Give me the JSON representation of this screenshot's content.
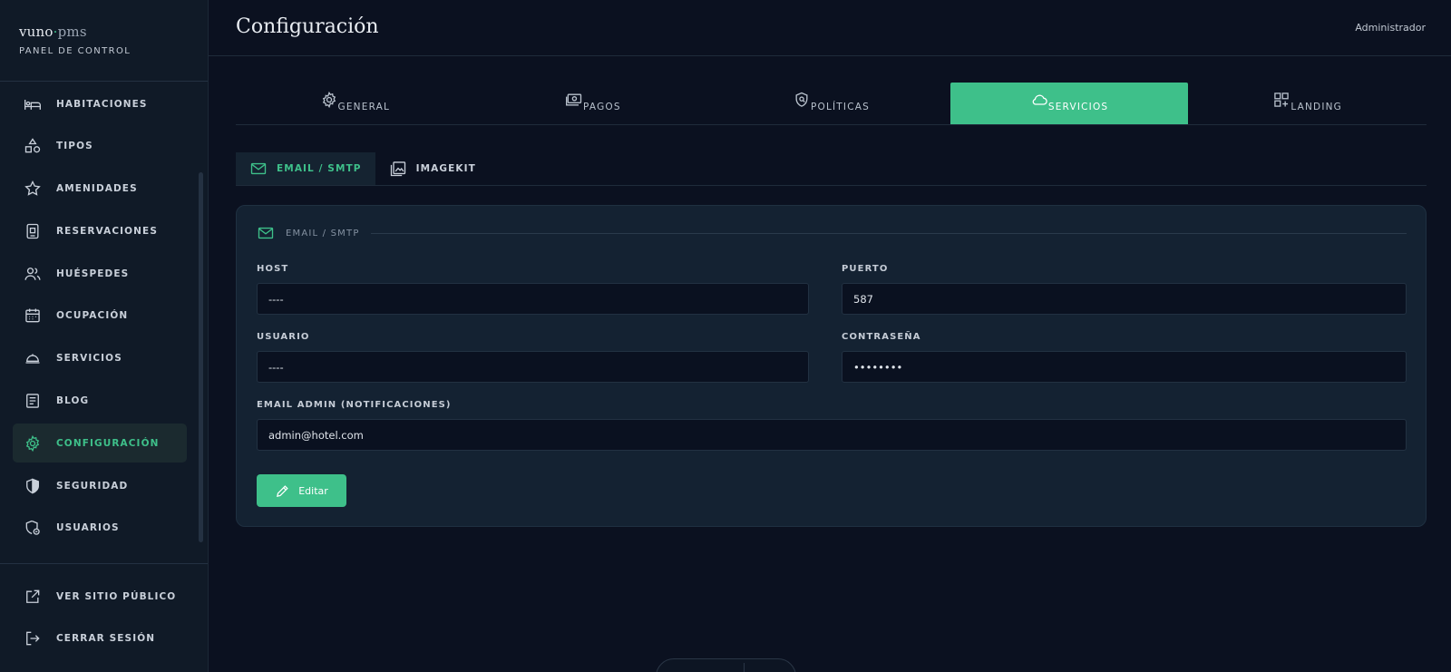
{
  "brand": {
    "logo_main": "vuno",
    "logo_dot": "·",
    "logo_pms": "pms",
    "subtitle": "PANEL DE CONTROL"
  },
  "sidebar": {
    "items": [
      {
        "label": "HABITACIONES",
        "icon": "bed-icon"
      },
      {
        "label": "TIPOS",
        "icon": "shapes-icon"
      },
      {
        "label": "AMENIDADES",
        "icon": "star-icon"
      },
      {
        "label": "RESERVACIONES",
        "icon": "booking-icon"
      },
      {
        "label": "HUÉSPEDES",
        "icon": "users-icon"
      },
      {
        "label": "OCUPACIÓN",
        "icon": "calendar-icon"
      },
      {
        "label": "SERVICIOS",
        "icon": "room-service-icon"
      },
      {
        "label": "BLOG",
        "icon": "document-icon"
      },
      {
        "label": "CONFIGURACIÓN",
        "icon": "gear-icon",
        "active": true
      },
      {
        "label": "SEGURIDAD",
        "icon": "shield-icon"
      },
      {
        "label": "USUARIOS",
        "icon": "user-shield-icon"
      }
    ],
    "bottom": [
      {
        "label": "VER SITIO PÚBLICO",
        "icon": "external-link-icon"
      },
      {
        "label": "CERRAR SESIÓN",
        "icon": "logout-icon"
      }
    ]
  },
  "header": {
    "title": "Configuración",
    "user": "Administrador"
  },
  "main_tabs": [
    {
      "label": "GENERAL",
      "icon": "gear-icon"
    },
    {
      "label": "PAGOS",
      "icon": "money-icon"
    },
    {
      "label": "POLÍTICAS",
      "icon": "policy-shield-icon"
    },
    {
      "label": "SERVICIOS",
      "icon": "cloud-icon",
      "active": true
    },
    {
      "label": "LANDING",
      "icon": "grid-plus-icon"
    }
  ],
  "sub_tabs": [
    {
      "label": "EMAIL / SMTP",
      "icon": "mail-icon",
      "active": true
    },
    {
      "label": "IMAGEKIT",
      "icon": "image-icon"
    }
  ],
  "form": {
    "section_title": "EMAIL / SMTP",
    "host_label": "HOST",
    "host_value": "----",
    "port_label": "PUERTO",
    "port_value": "587",
    "user_label": "USUARIO",
    "user_value": "----",
    "password_label": "CONTRASEÑA",
    "password_value": "••••••••",
    "admin_email_label": "EMAIL ADMIN (NOTIFICACIONES)",
    "admin_email_value": "admin@hotel.com",
    "edit_button": "Editar"
  },
  "colors": {
    "accent": "#3ec08a",
    "background": "#0b1120",
    "sidebar": "#101a27",
    "card": "#142232"
  }
}
